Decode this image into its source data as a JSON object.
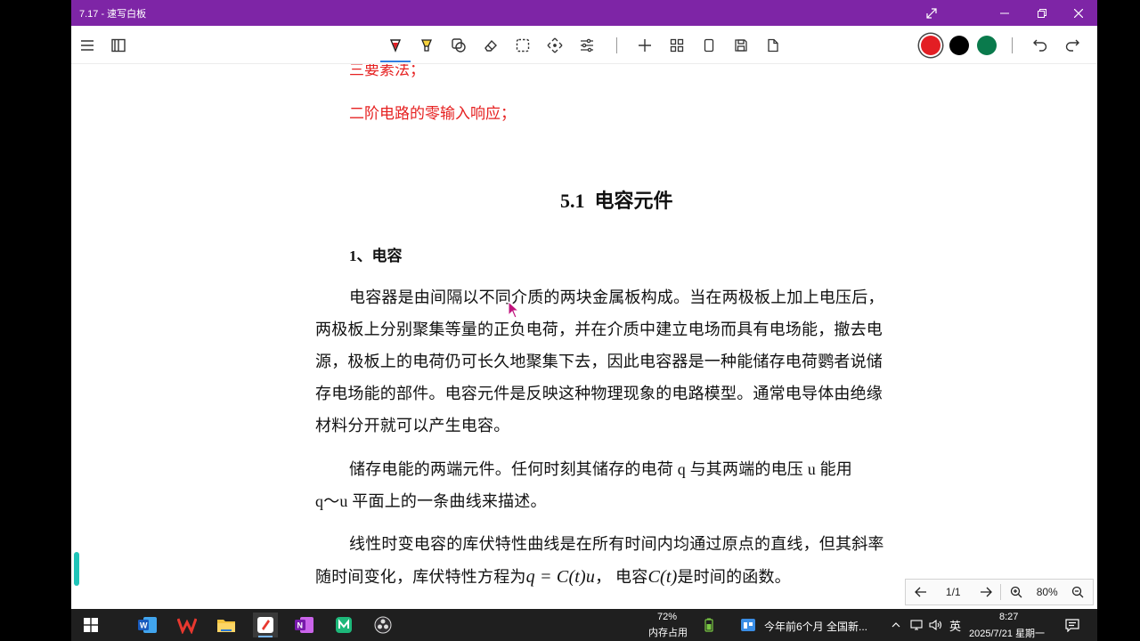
{
  "window": {
    "title": "7.17 - 速写白板"
  },
  "toolbar": {
    "colors": [
      "#e31e24",
      "#000000",
      "#0a7a4c"
    ]
  },
  "document": {
    "red_line_1": "三要素法；",
    "red_line_2": "二阶电路的零输入响应；",
    "heading_num": "5.1",
    "heading_text": "电容元件",
    "subheading": "1、电容",
    "p1": [
      "电容器是由间隔以不同介质的两块金属板构成。当在两极板上加上电压后，",
      "两极板上分别聚集等量的正负电荷，并在介质中建立电场而具有电场能，撤去电",
      "源，极板上的电荷仍可长久地聚集下去，因此电容器是一种能储存电荷鹦者说储",
      "存电场能的部件。电容元件是反映这种物理现象的电路模型。通常电导体由绝缘",
      "材料分开就可以产生电容。"
    ],
    "p2": [
      "储存电能的两端元件。任何时刻其储存的电荷 q 与其两端的电压 u 能用",
      "q～u 平面上的一条曲线来描述。"
    ],
    "p3_line1": "线性时变电容的库伏特性曲线是在所有时间内均通过原点的直线，但其斜率",
    "p3_line2_a": "随时间变化，库伏特性方程为",
    "p3_formula": "q = C(t)u",
    "p3_line2_b": "， 电容",
    "p3_formula2": "C(t)",
    "p3_line2_c": "是时间的函数。"
  },
  "pager": {
    "page": "1/1",
    "zoom": "80%"
  },
  "taskbar": {
    "mem_percent": "72%",
    "mem_label": "内存占用",
    "news": "今年前6个月 全国新...",
    "ime": "英",
    "time": "8:27",
    "date": "2025/7/21 星期一"
  }
}
